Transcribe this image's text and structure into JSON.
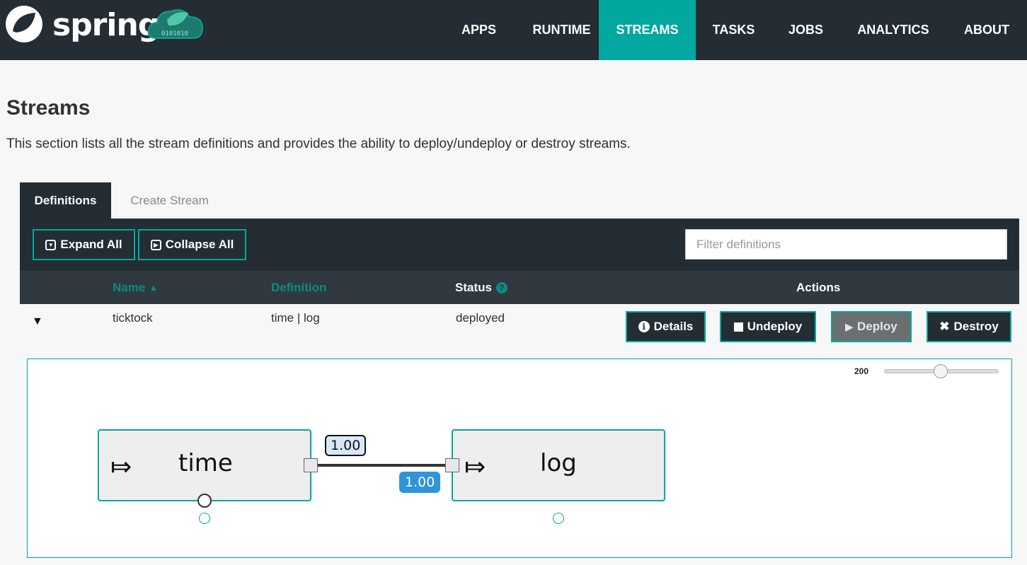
{
  "brand": {
    "name": "spring",
    "logo_badge": "cloud"
  },
  "nav": [
    {
      "label": "APPS",
      "active": false
    },
    {
      "label": "RUNTIME",
      "active": false
    },
    {
      "label": "STREAMS",
      "active": true
    },
    {
      "label": "TASKS",
      "active": false
    },
    {
      "label": "JOBS",
      "active": false
    },
    {
      "label": "ANALYTICS",
      "active": false
    },
    {
      "label": "ABOUT",
      "active": false
    }
  ],
  "page": {
    "title": "Streams",
    "description": "This section lists all the stream definitions and provides the ability to deploy/undeploy or destroy streams."
  },
  "tabs": [
    {
      "label": "Definitions",
      "active": true
    },
    {
      "label": "Create Stream",
      "active": false
    }
  ],
  "toolbar": {
    "expand_all": "Expand All",
    "collapse_all": "Collapse All",
    "filter_placeholder": "Filter definitions",
    "filter_value": ""
  },
  "table": {
    "columns": {
      "name": "Name",
      "definition": "Definition",
      "status": "Status",
      "actions": "Actions"
    },
    "sort": {
      "column": "name",
      "direction": "asc"
    },
    "rows": [
      {
        "name": "ticktock",
        "definition": "time | log",
        "status": "deployed",
        "expanded": true,
        "actions": {
          "details": "Details",
          "undeploy": "Undeploy",
          "deploy": "Deploy",
          "destroy": "Destroy"
        }
      }
    ]
  },
  "graph": {
    "zoom": 200,
    "zoom_min": 5,
    "zoom_max": 400,
    "nodes": [
      {
        "label": "time",
        "icon": "source-arrow-icon"
      },
      {
        "label": "log",
        "icon": "sink-arrow-icon"
      }
    ],
    "link": {
      "source_rate": "1.00",
      "target_rate": "1.00"
    }
  },
  "colors": {
    "navbar": "#232d33",
    "accent": "#00a8a0",
    "badge_blue": "#2f94d9"
  }
}
